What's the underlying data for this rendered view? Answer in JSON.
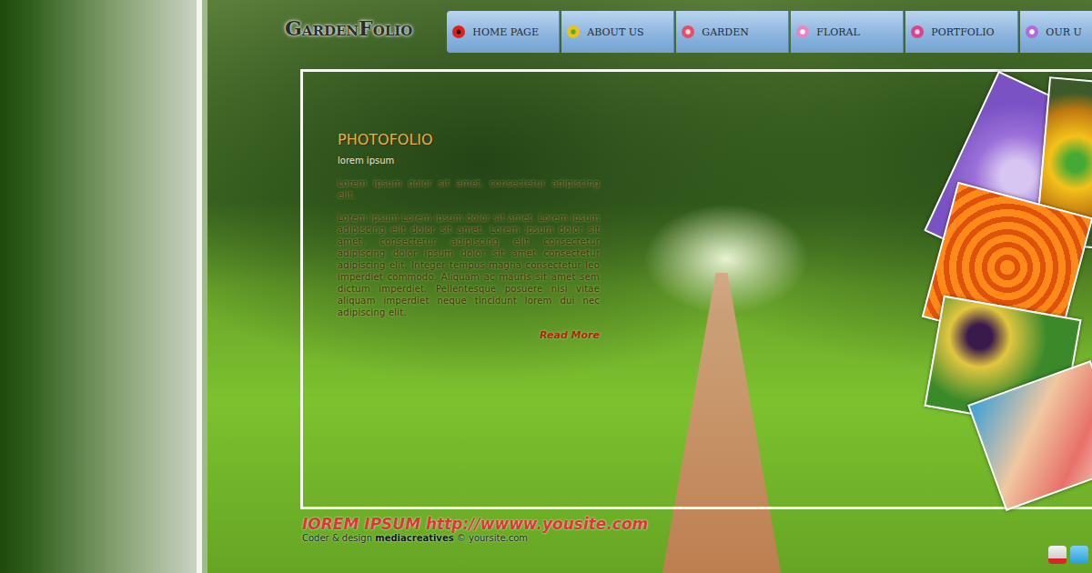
{
  "logo": "GardenFolio",
  "nav": [
    {
      "label": "HOME PAGE"
    },
    {
      "label": "ABOUT US"
    },
    {
      "label": "GARDEN"
    },
    {
      "label": "FLORAL"
    },
    {
      "label": "PORTFOLIO"
    },
    {
      "label": "OUR U"
    }
  ],
  "content": {
    "title": "PHOTOFOLIO",
    "subtitle": "lorem ipsum",
    "paragraphs": [
      "Lorem ipsum dolor sit amet, consectetur adipiscing elit.",
      "Lorem ipsum Lorem ipsum dolor sit amet. Lorem ipsum adipiscing elit dolor sit amet. Lorem ipsum dolor sit amet, consectetur adipiscing elit consectetur adipiscing dolor ipsum dolor sit amet consectetur adipiscing elit. Integer tempus magna consectetur leo imperdiet commodo. Aliquam ac mauris sit amet sem dictum imperdiet. Pellentesque posuere nisi vitae aliquam imperdiet neque tincidunt lorem dui nec adipiscing elit."
    ],
    "read_more": "Read More"
  },
  "footer": {
    "headline": "IOREM IPSUM http://wwww.yousite.com",
    "credit_prefix": "Coder & design",
    "credit_name": "mediacreatives",
    "credit_suffix": "© yoursite.com"
  }
}
